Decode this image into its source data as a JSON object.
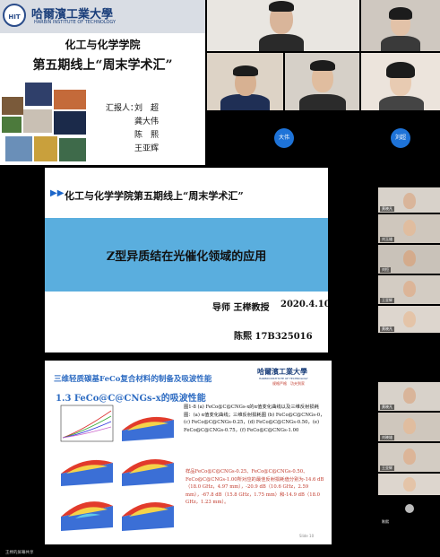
{
  "slide1": {
    "logo_text": "HIT",
    "university_cn": "哈爾濱工業大學",
    "university_en": "HARBIN INSTITUTE OF TECHNOLOGY",
    "department": "化工与化学学院",
    "title": "第五期线上“周末学术汇”",
    "reporter_label": "汇报人：",
    "reporters": [
      "刘　超",
      "龚大伟",
      "陈　熙",
      "王亚辉"
    ]
  },
  "video_main": {
    "avatar_1": "大伟",
    "avatar_2": "刘超"
  },
  "side_tiles": [
    {
      "name": "黄晓凡"
    },
    {
      "name": "刘玉雄"
    },
    {
      "name": "刘恒"
    },
    {
      "name": "王亚辉"
    },
    {
      "name": "黄晓凡"
    },
    {
      "name": "黄晓凡"
    },
    {
      "name": "刘晓雄"
    },
    {
      "name": "王亚辉"
    },
    {
      "name": "陈熙"
    }
  ],
  "slide2": {
    "arrows": "▶▶",
    "title": "化工与化学学院第五期线上“周末学术汇”",
    "topic": "Z型异质结在光催化领域的应用",
    "advisor": "导师 王榉教授",
    "date": "2020.4.10",
    "author": "陈熙 17B325016"
  },
  "slide3": {
    "title": "三维轻质碳基FeCo复合材料的制备及吸波性能",
    "university_cn": "哈爾濱工業大學",
    "university_en": "HARBIN INSTITUTE OF TECHNOLOGY",
    "motto": "规格严格　功夫到家",
    "subtitle": "1.3 FeCo@C@CNGs-x的吸波性能",
    "caption": "图1-8 (a) FeCo@C@CNGs-x的α值变化曲线以及三维反射损耗图：(a) α值变化曲线；三维反射损耗图 (b) FeCo@C@CNGs-0，(c) FeCo@C@CNGs-0.25，(d) FeCo@C@CNGs-0.50，(e) FeCo@C@CNGs-0.75，(f) FeCo@C@CNGs-1.00",
    "result": "样品FeCo@C@CNGs-0.25、FeCo@C@CNGs-0.50、FeCo@C@CNGs-1.00所对应的最佳反射损耗值分别为-14.6 dB（18.0 GHz，4.97 mm），-20.9 dB（10.6 GHz，2.59 mm），-67.8 dB（15.8 GHz，1.75 mm）和-14.9 dB（18.0 GHz，1.23 mm）。",
    "slide_no": "Slide 10"
  },
  "taskbar": {
    "label": "王榉的屏幕共享"
  },
  "colors": {
    "slide_blue_band": "#5aaede",
    "title_blue": "#2e6cc2",
    "avatar_blue": "#1e73d8"
  }
}
